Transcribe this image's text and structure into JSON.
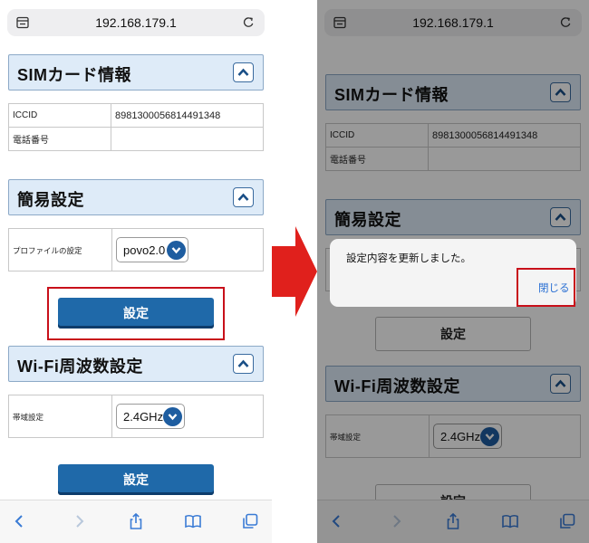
{
  "browser": {
    "url": "192.168.179.1"
  },
  "sim_section": {
    "title": "SIMカード情報",
    "rows": [
      {
        "label": "ICCID",
        "value": "8981300056814491348"
      },
      {
        "label": "電話番号",
        "value": ""
      }
    ]
  },
  "simple_section": {
    "title": "簡易設定",
    "profile_label": "プロファイルの設定",
    "profile_value": "povo2.0"
  },
  "wifi_section": {
    "title": "Wi-Fi周波数設定",
    "band_label": "帯域設定",
    "band_value": "2.4GHz"
  },
  "buttons": {
    "apply_label": "設定"
  },
  "dialog": {
    "message": "設定内容を更新しました。",
    "close_label": "閉じる"
  },
  "colors": {
    "section_header_bg": "#deebf8",
    "primary_button": "#1f69a9",
    "highlight_red": "#c8101a",
    "arrow_red": "#e0201c",
    "link_blue": "#2a6fd3"
  },
  "icons": {
    "tabs": "tabs-icon",
    "reload": "reload-icon",
    "back": "back-icon",
    "forward": "forward-icon",
    "share": "share-icon",
    "bookmarks": "bookmarks-icon",
    "tab_switcher": "tab-switcher-icon",
    "collapse": "chevron-up-icon",
    "select": "chevron-down-icon",
    "step_arrow": "right-arrow-icon"
  }
}
